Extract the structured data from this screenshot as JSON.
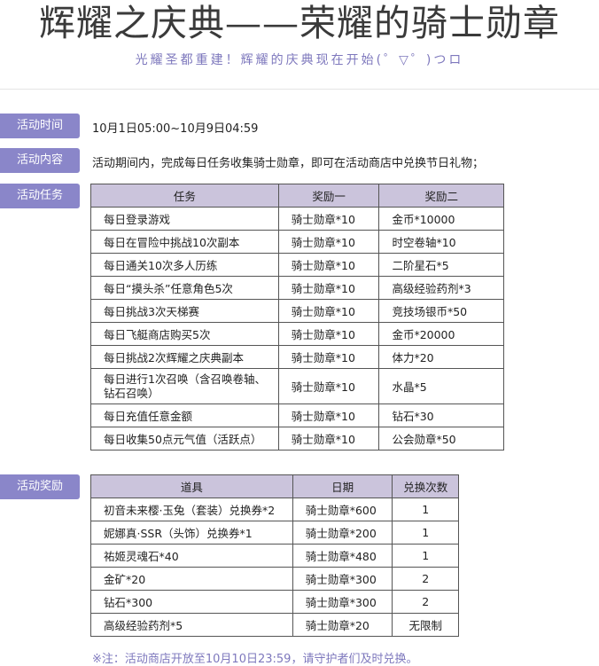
{
  "header": {
    "title": "辉耀之庆典——荣耀的骑士勋章",
    "subtitle": "光耀圣都重建！辉耀的庆典现在开始(゜▽゜)つロ"
  },
  "sections": {
    "time_label": "活动时间",
    "time_value": "10月1日05:00~10月9日04:59",
    "content_label": "活动内容",
    "content_value": "活动期间内，完成每日任务收集骑士勋章，即可在活动商店中兑换节日礼物；",
    "tasks_label": "活动任务",
    "rewards_label": "活动奖励"
  },
  "task_table": {
    "headers": [
      "任务",
      "奖励一",
      "奖励二"
    ],
    "rows": [
      [
        "每日登录游戏",
        "骑士勋章*10",
        "金币*10000"
      ],
      [
        "每日在冒险中挑战10次副本",
        "骑士勋章*10",
        "时空卷轴*10"
      ],
      [
        "每日通关10次多人历练",
        "骑士勋章*10",
        "二阶星石*5"
      ],
      [
        "每日“摸头杀”任意角色5次",
        "骑士勋章*10",
        "高级经验药剂*3"
      ],
      [
        "每日挑战3次天梯赛",
        "骑士勋章*10",
        "竞技场银币*50"
      ],
      [
        "每日飞艇商店购买5次",
        "骑士勋章*10",
        "金币*20000"
      ],
      [
        "每日挑战2次辉耀之庆典副本",
        "骑士勋章*10",
        "体力*20"
      ],
      [
        "每日进行1次召唤（含召唤卷轴、钻石召唤）",
        "骑士勋章*10",
        "水晶*5"
      ],
      [
        "每日充值任意金额",
        "骑士勋章*10",
        "钻石*30"
      ],
      [
        "每日收集50点元气值（活跃点）",
        "骑士勋章*10",
        "公会勋章*50"
      ]
    ]
  },
  "reward_table": {
    "headers": [
      "道具",
      "日期",
      "兑换次数"
    ],
    "rows": [
      [
        "初音未来樱·玉兔（套装）兑换券*2",
        "骑士勋章*600",
        "1"
      ],
      [
        "妮娜真·SSR（头饰）兑换券*1",
        "骑士勋章*200",
        "1"
      ],
      [
        "祐姬灵魂石*40",
        "骑士勋章*480",
        "1"
      ],
      [
        "金矿*20",
        "骑士勋章*300",
        "2"
      ],
      [
        "钻石*300",
        "骑士勋章*300",
        "2"
      ],
      [
        "高级经验药剂*5",
        "骑士勋章*20",
        "无限制"
      ]
    ]
  },
  "note": "※注：活动商店开放至10月10日23:59，请守护者们及时兑换。",
  "colors": {
    "accent": "#8a86c9",
    "header_bg": "#cbc4dc",
    "subtitle": "#7e78bd"
  }
}
